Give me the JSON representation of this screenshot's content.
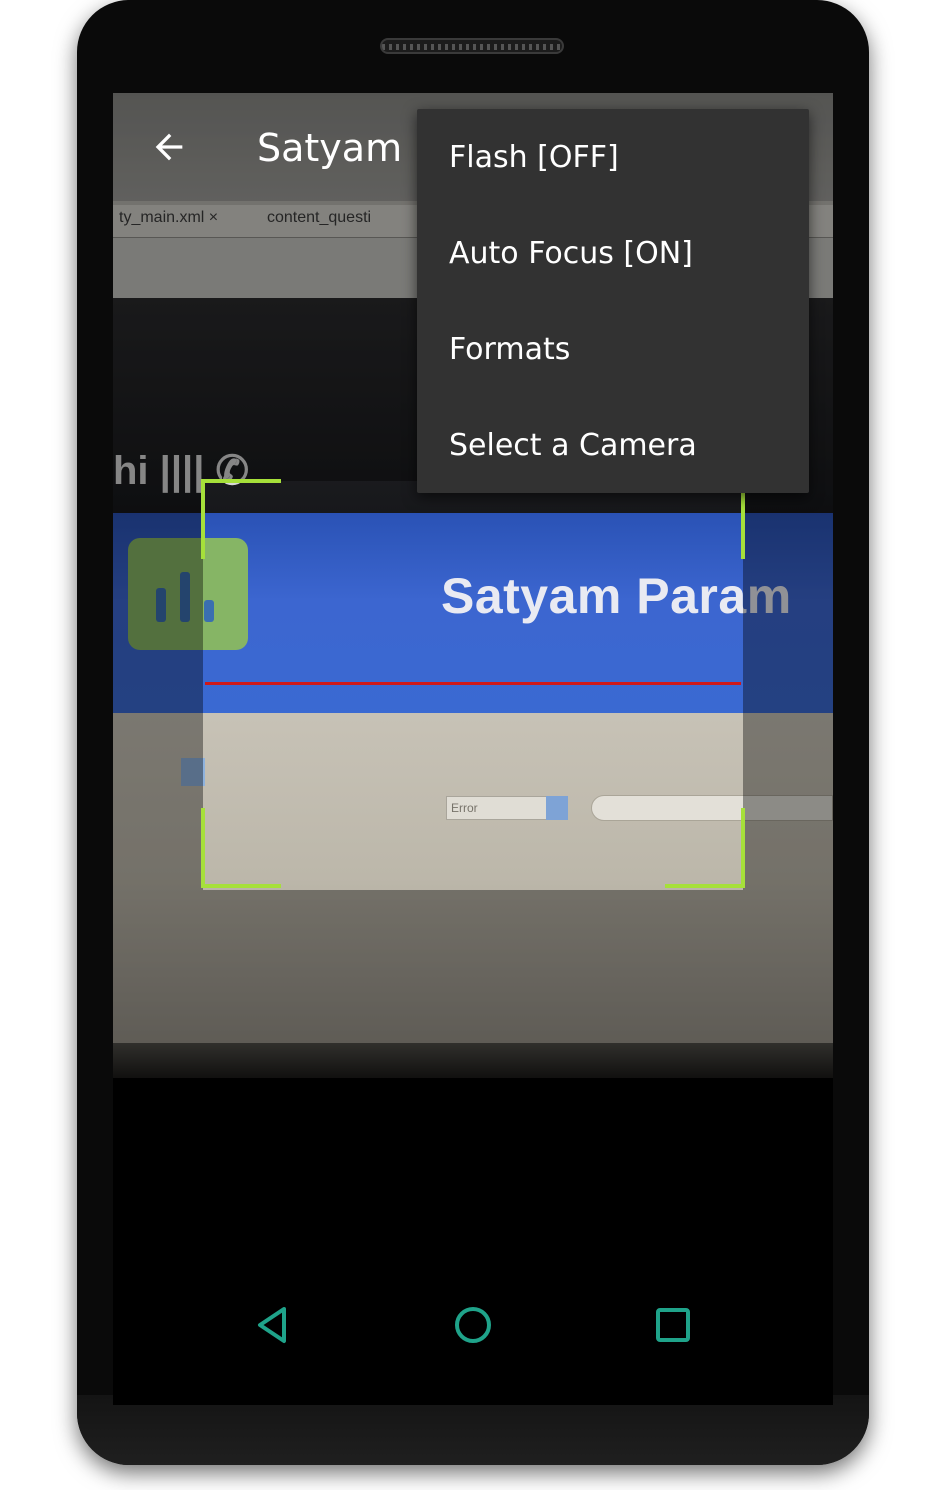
{
  "toolbar": {
    "title": "Satyam Param",
    "back_icon": "arrow-back-icon"
  },
  "menu": {
    "items": [
      {
        "label": "Flash [OFF]"
      },
      {
        "label": "Auto Focus [ON]"
      },
      {
        "label": "Formats"
      },
      {
        "label": "Select a Camera"
      }
    ]
  },
  "camera_preview": {
    "tab_1": "ty_main.xml ×",
    "tab_2": "content_questi",
    "heading": "Satyam Param",
    "left_icons": "hi  |||| ✆",
    "select_text": "Error"
  },
  "navbar": {
    "back_icon": "triangle-back-icon",
    "home_icon": "circle-home-icon",
    "recents_icon": "square-recents-icon"
  },
  "colors": {
    "viewfinder": "#a6e03a",
    "laser": "#d01818",
    "menu_bg": "#323232",
    "nav_icon": "#1fa38a"
  }
}
